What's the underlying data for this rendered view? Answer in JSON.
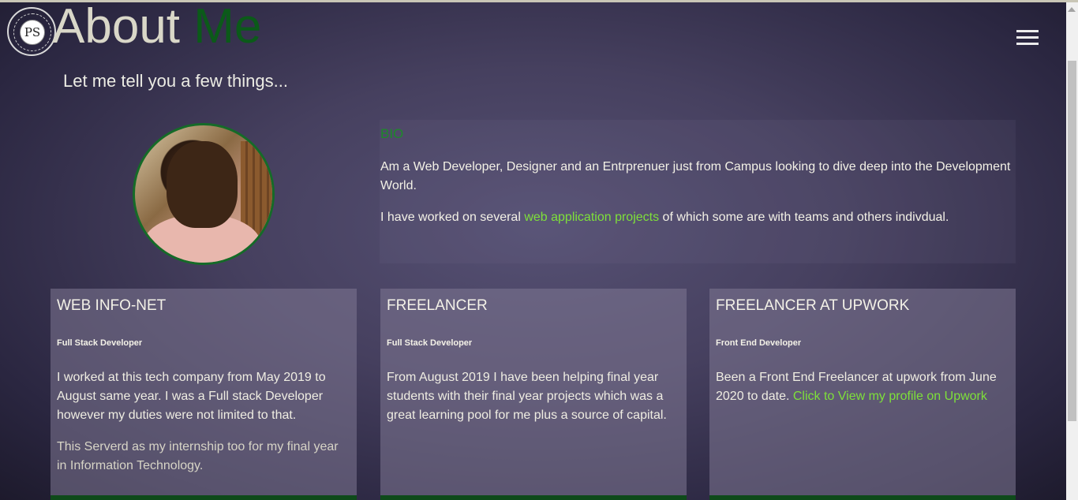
{
  "header": {
    "logo_text": "PS",
    "title_word1": "About",
    "title_word2": "Me",
    "menu_icon": "hamburger-icon"
  },
  "subtitle": "Let me tell you a few things...",
  "bio": {
    "heading": "BIO",
    "p1": "Am a Web Developer, Designer and an Entrprenuer just from Campus looking to dive deep into the Development World.",
    "p2_before": "I have worked on several ",
    "p2_link": "web application projects",
    "p2_after": " of which some are with teams and others indivdual."
  },
  "cards": [
    {
      "title": "WEB INFO-NET",
      "role": "Full Stack Developer",
      "text": "I worked at this tech company from May 2019 to August same year. I was a Full stack Developer however my duties were not limited to that.",
      "text2": "This Serverd as my internship too for my final year in Information Technology."
    },
    {
      "title": "FREELANCER",
      "role": "Full Stack Developer",
      "text": "From August 2019 I have been helping final year students with their final year projects which was a great learning pool for me plus a source of capital."
    },
    {
      "title": "FREELANCER AT UPWORK",
      "role": "Front End Developer",
      "text_before": "Been a Front End Freelancer at upwork from June 2020 to date. ",
      "text_link": "Click to View my profile on Upwork"
    }
  ],
  "colors": {
    "accent_green": "#0b5a19",
    "link_green": "#7ee03a",
    "bio_heading": "#1d8a2a"
  }
}
